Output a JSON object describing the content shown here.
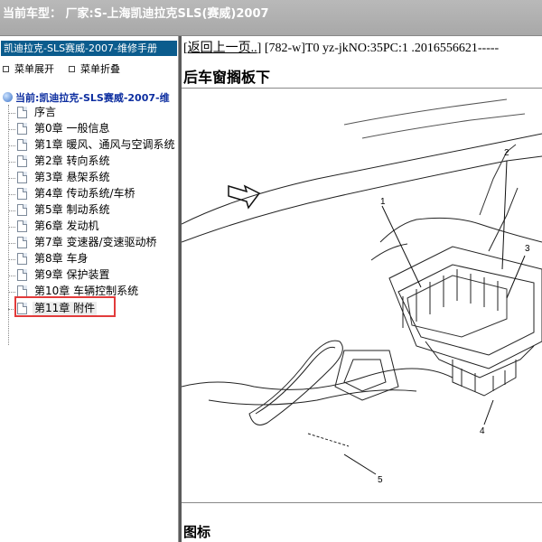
{
  "window": {
    "title": "当前车型：  厂家:S-上海凯迪拉克SLS(赛威)2007"
  },
  "left": {
    "manual_header": "凯迪拉克-SLS赛威-2007-维修手册",
    "expand_all": "菜单展开",
    "collapse_all": "菜单折叠",
    "root_label": "当前:凯迪拉克-SLS赛威-2007-维",
    "tree": [
      {
        "label": "序言"
      },
      {
        "label": "第0章 一般信息"
      },
      {
        "label": "第1章 暖风、通风与空调系统"
      },
      {
        "label": "第2章 转向系统"
      },
      {
        "label": "第3章 悬架系统"
      },
      {
        "label": "第4章 传动系统/车桥"
      },
      {
        "label": "第5章 制动系统"
      },
      {
        "label": "第6章 发动机"
      },
      {
        "label": "第7章 变速器/变速驱动桥"
      },
      {
        "label": "第8章 车身"
      },
      {
        "label": "第9章 保护装置"
      },
      {
        "label": "第10章 车辆控制系统"
      },
      {
        "label": "第11章 附件",
        "selected": true
      }
    ]
  },
  "content": {
    "back_link": "返回上一页..",
    "nav_info": " [782-w]T0 yz-jkNO:35PC:1 .2016556621-----",
    "page_title": "后车窗搁板下",
    "callouts": [
      "1",
      "2",
      "3",
      "4",
      "5"
    ],
    "legend_title": "图标"
  },
  "colors": {
    "header_bg": "#0b5c8d",
    "highlight": "#e23b3b",
    "root_text": "#0d2ea0"
  }
}
